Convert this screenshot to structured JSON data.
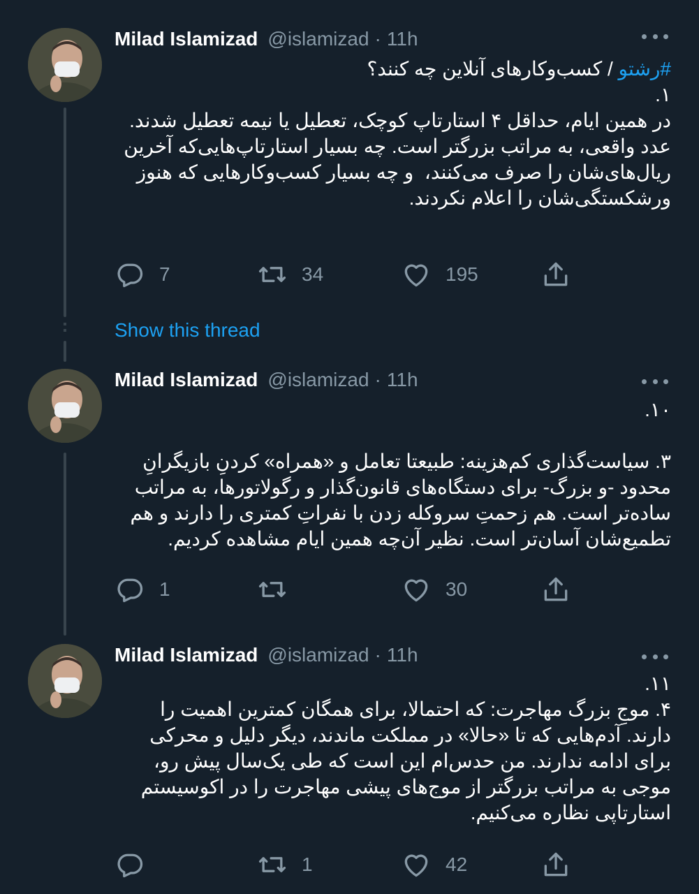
{
  "tweets": [
    {
      "name": "Milad Islamizad",
      "handle": "@islamizad",
      "sep": "·",
      "time": "11h",
      "hashtag": "#رشتو",
      "headline": " / کسب‌وکارهای آنلاین چه کنند؟",
      "text": "\n۱.\nدر همین ایام، حداقل ۴ استارتاپ کوچک، تعطیل یا نیمه تعطیل شدند. عدد واقعی، به مراتب بزرگتر است. چه بسیار استارتاپ‌هایی‌که آخرین ریال‌های‌شان را صرف می‌کنند،  و چه بسیار کسب‌وکارهایی که هنوز ورشکستگی‌شان را اعلام نکردند.",
      "replies": "7",
      "retweets": "34",
      "likes": "195"
    },
    {
      "name": "Milad Islamizad",
      "handle": "@islamizad",
      "sep": "·",
      "time": "11h",
      "text": "۱۰.\n\n۳. سیاست‌گذاری کم‌هزینه: طبیعتا تعامل و «همراه» کردنِ بازیگرانِ محدود -و بزرگ- برای دستگاه‌های قانون‌گذار و رگولاتورها، به مراتب ساده‌تر است. هم زحمتِ سروکله زدن با نفراتِ کمتری را دارند و هم تطمیع‌شان آسان‌تر است. نظیر آن‌چه همین ایام مشاهده کردیم.",
      "replies": "1",
      "retweets": "",
      "likes": "30"
    },
    {
      "name": "Milad Islamizad",
      "handle": "@islamizad",
      "sep": "·",
      "time": "11h",
      "text": "۱۱.\n۴. موجِ بزرگ مهاجرت: که احتمالا، برای همگان کمترین اهمیت را دارند. آدم‌هایی که تا «حالا» در مملکت ماندند، دیگر دلیل و محرکی برای ادامه ندارند. من حدس‌ام این است که طی یک‌سال پیش رو، موجی به مراتب بزرگتر از موج‌های پیشی مهاجرت را در اکوسیستم استارتاپی نظاره می‌کنیم.",
      "replies": "",
      "retweets": "1",
      "likes": "42"
    }
  ],
  "show_thread": "Show this thread",
  "icons": {
    "reply": "reply-icon",
    "retweet": "retweet-icon",
    "like": "like-icon",
    "share": "share-icon",
    "more": "more-icon"
  },
  "colors": {
    "background": "#15202b",
    "accent": "#1da1f2",
    "muted": "#8899a6",
    "line": "#38444d"
  }
}
